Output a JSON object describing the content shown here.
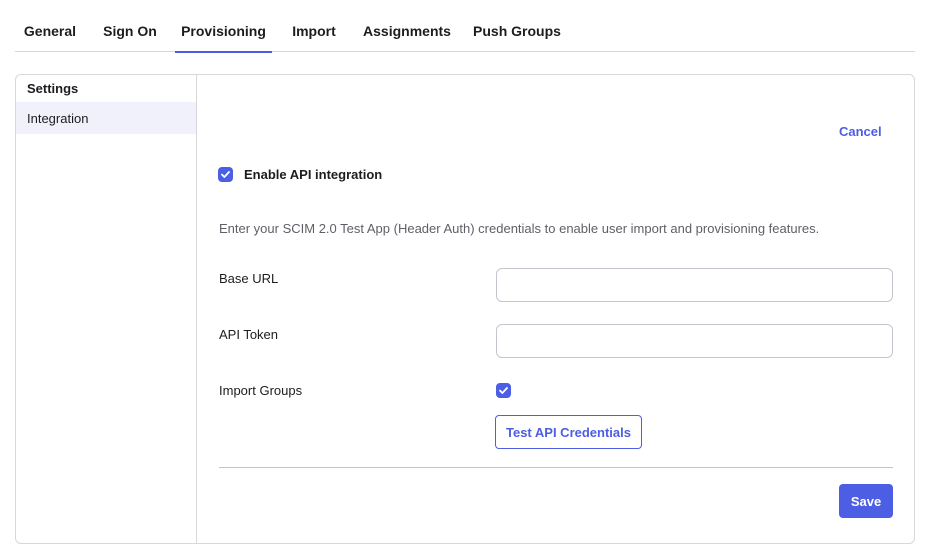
{
  "tabs": [
    {
      "label": "General",
      "active": false
    },
    {
      "label": "Sign On",
      "active": false
    },
    {
      "label": "Provisioning",
      "active": true
    },
    {
      "label": "Import",
      "active": false
    },
    {
      "label": "Assignments",
      "active": false
    },
    {
      "label": "Push Groups",
      "active": false
    }
  ],
  "sidenav": {
    "heading": "Settings",
    "items": [
      {
        "label": "Integration",
        "selected": true
      }
    ]
  },
  "form": {
    "cancel_label": "Cancel",
    "enable_api": {
      "label": "Enable API integration",
      "checked": true
    },
    "description": "Enter your SCIM 2.0 Test App (Header Auth) credentials to enable user import and provisioning features.",
    "base_url": {
      "label": "Base URL",
      "value": "",
      "placeholder": ""
    },
    "api_token": {
      "label": "API Token",
      "value": "",
      "placeholder": ""
    },
    "import_groups": {
      "label": "Import Groups",
      "checked": true
    },
    "test_button_label": "Test API Credentials",
    "save_button_label": "Save"
  },
  "colors": {
    "accent": "#4b5ee4",
    "selected_nav_bg": "#f0f1fb",
    "border": "#d7d7dc",
    "muted_text": "#5f6067"
  },
  "icons": {
    "checkbox_check": "checkmark-icon"
  }
}
